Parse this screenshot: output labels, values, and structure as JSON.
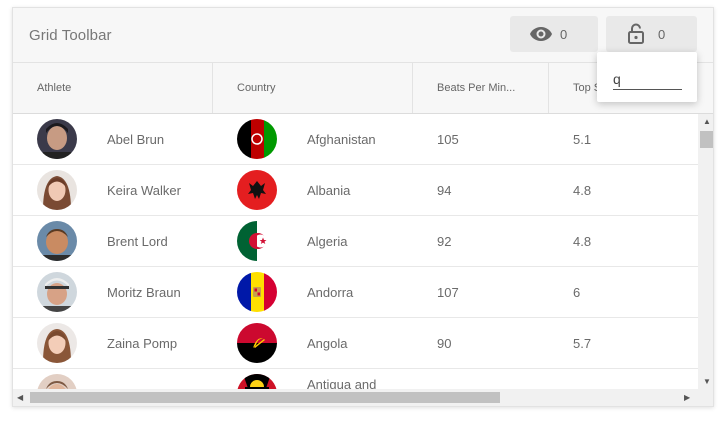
{
  "toolbar": {
    "title": "Grid Toolbar",
    "hidden_columns_count": "0",
    "locked_columns_count": "0"
  },
  "columns": [
    "Athlete",
    "Country",
    "Beats Per Min...",
    "Top S"
  ],
  "rows": [
    {
      "athlete": "Abel Brun",
      "country": "Afghanistan",
      "bpm": "105",
      "top_speed": "5.1"
    },
    {
      "athlete": "Keira Walker",
      "country": "Albania",
      "bpm": "94",
      "top_speed": "4.8"
    },
    {
      "athlete": "Brent Lord",
      "country": "Algeria",
      "bpm": "92",
      "top_speed": "4.8"
    },
    {
      "athlete": "Moritz Braun",
      "country": "Andorra",
      "bpm": "107",
      "top_speed": "6"
    },
    {
      "athlete": "Zaina Pomp",
      "country": "Angola",
      "bpm": "90",
      "top_speed": "5.7"
    },
    {
      "athlete": "",
      "country": "Antigua and",
      "bpm": "",
      "top_speed": ""
    }
  ],
  "pin_popup": {
    "input_value": "q"
  },
  "colors": {
    "toolbar_bg": "#f7f7f7",
    "button_bg": "#e9e9e9",
    "text": "#6a6a6a"
  },
  "icons": {
    "hide": "eye-icon",
    "lock": "unlock-icon"
  }
}
